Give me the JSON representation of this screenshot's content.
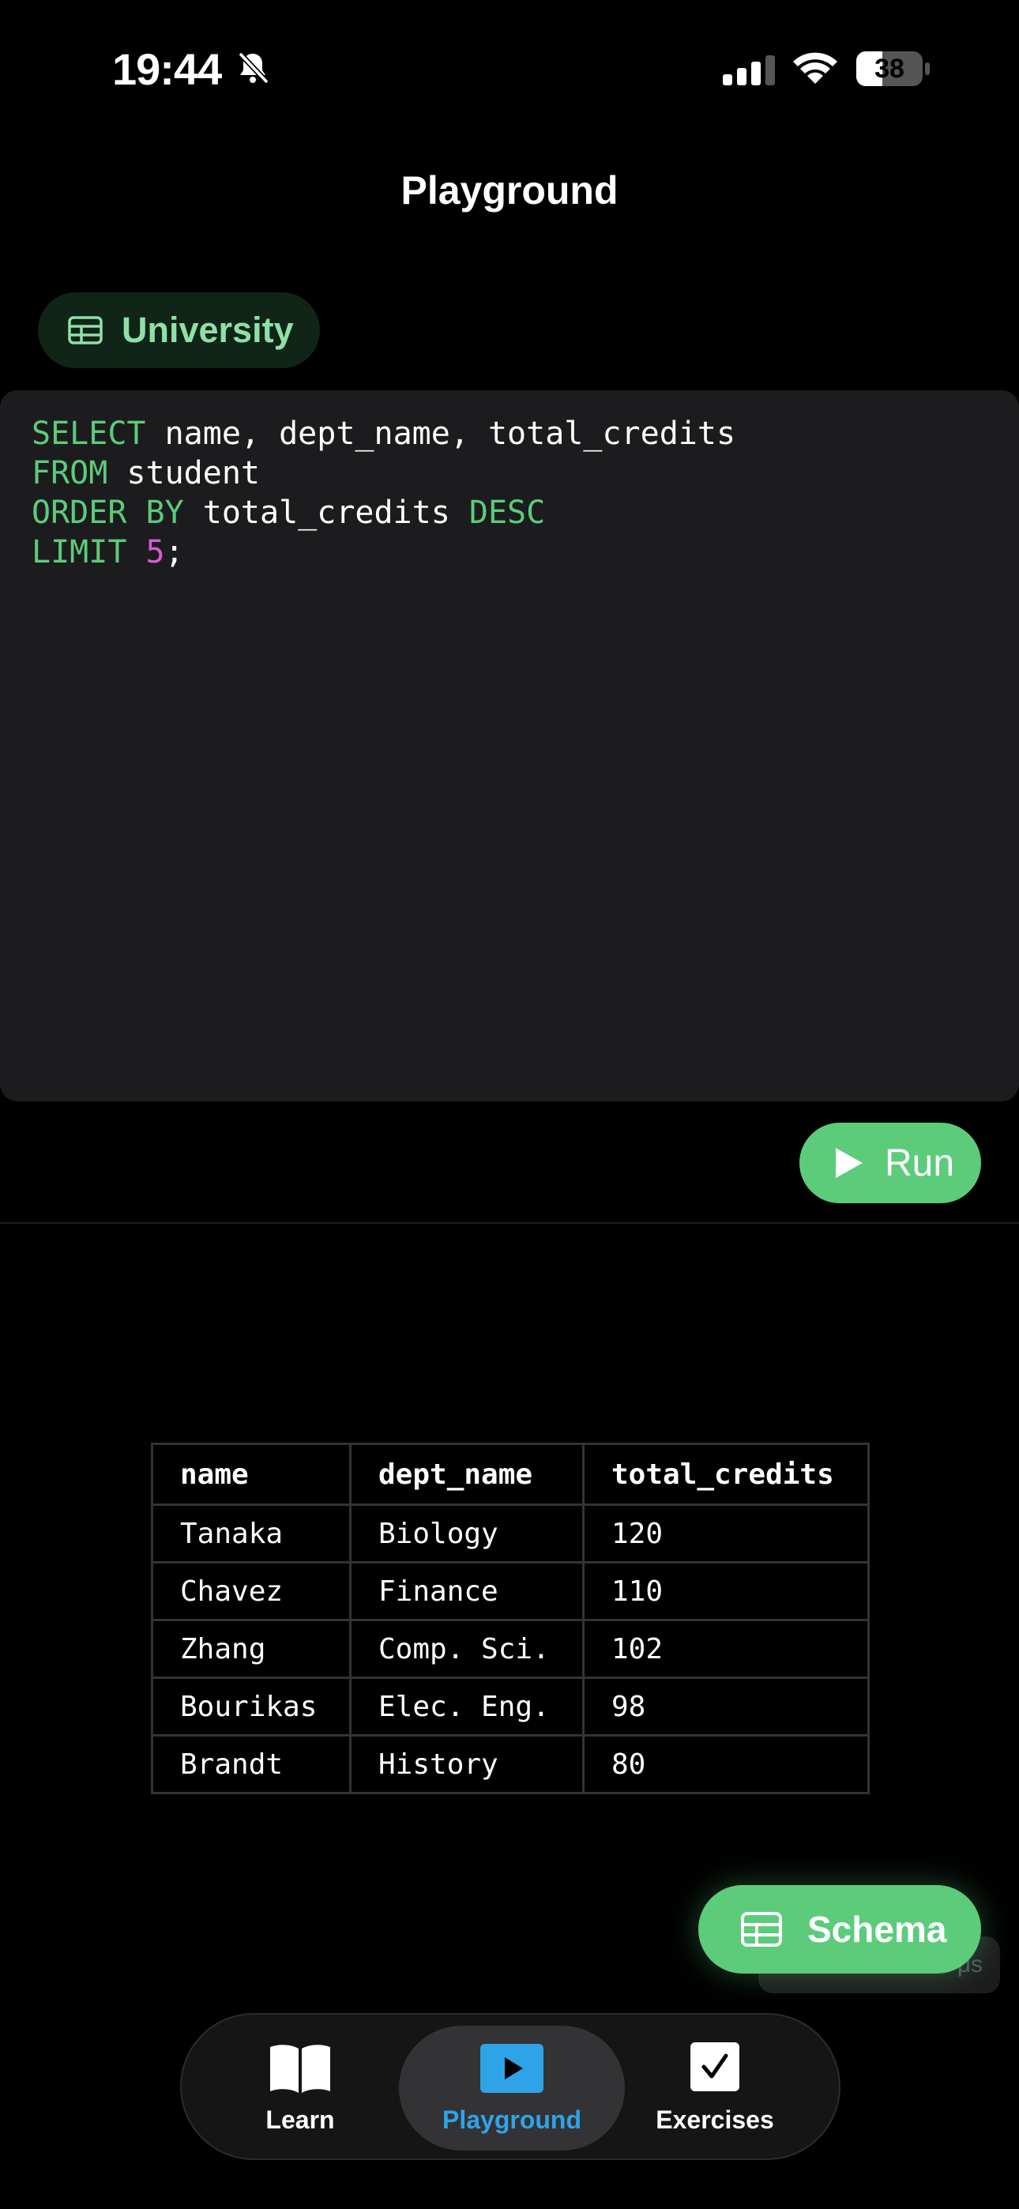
{
  "status_bar": {
    "time": "19:44",
    "battery": "38"
  },
  "nav": {
    "title": "Playground"
  },
  "database_chip": {
    "label": "University",
    "icon": "table-icon"
  },
  "editor": {
    "lines": [
      [
        {
          "t": "SELECT",
          "k": "kw"
        },
        {
          "t": " name, dept_name, total_credits",
          "k": "txt"
        }
      ],
      [
        {
          "t": "FROM",
          "k": "kw"
        },
        {
          "t": " student",
          "k": "txt"
        }
      ],
      [
        {
          "t": "ORDER BY",
          "k": "kw"
        },
        {
          "t": " total_credits ",
          "k": "txt"
        },
        {
          "t": "DESC",
          "k": "kw"
        }
      ],
      [
        {
          "t": "LIMIT",
          "k": "kw"
        },
        {
          "t": " ",
          "k": "txt"
        },
        {
          "t": "5",
          "k": "num"
        },
        {
          "t": ";",
          "k": "txt"
        }
      ]
    ]
  },
  "run_button": {
    "label": "Run",
    "icon": "play-icon"
  },
  "results": {
    "columns": [
      "name",
      "dept_name",
      "total_credits"
    ],
    "rows": [
      [
        "Tanaka",
        "Biology",
        "120"
      ],
      [
        "Chavez",
        "Finance",
        "110"
      ],
      [
        "Zhang",
        "Comp. Sci.",
        "102"
      ],
      [
        "Bourikas",
        "Elec. Eng.",
        "98"
      ],
      [
        "Brandt",
        "History",
        "80"
      ]
    ]
  },
  "ghost_toast": {
    "text": "μs"
  },
  "schema_button": {
    "label": "Schema",
    "icon": "table-icon"
  },
  "tab_bar": {
    "tabs": [
      {
        "label": "Learn",
        "icon": "book-icon",
        "active": false
      },
      {
        "label": "Playground",
        "icon": "play-square-icon",
        "active": true
      },
      {
        "label": "Exercises",
        "icon": "checkbox-icon",
        "active": false
      }
    ]
  },
  "colors": {
    "accent_green": "#5ccc7a",
    "accent_blue": "#2fa3e8",
    "editor_bg": "#1c1c1e",
    "keyword": "#5ccc7a",
    "number": "#d85ad8"
  }
}
